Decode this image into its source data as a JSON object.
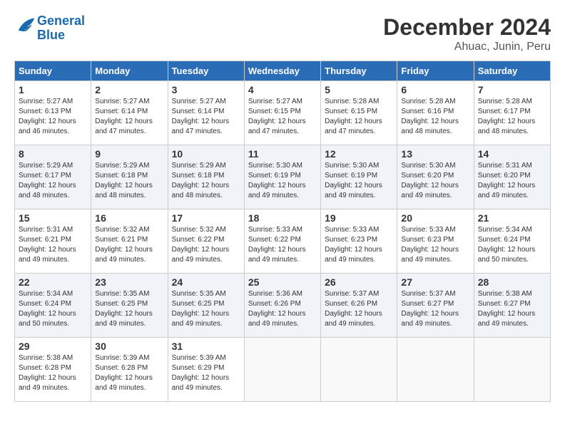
{
  "logo": {
    "line1": "General",
    "line2": "Blue"
  },
  "title": "December 2024",
  "location": "Ahuac, Junin, Peru",
  "days_of_week": [
    "Sunday",
    "Monday",
    "Tuesday",
    "Wednesday",
    "Thursday",
    "Friday",
    "Saturday"
  ],
  "weeks": [
    [
      {
        "day": "1",
        "info": "Sunrise: 5:27 AM\nSunset: 6:13 PM\nDaylight: 12 hours\nand 46 minutes."
      },
      {
        "day": "2",
        "info": "Sunrise: 5:27 AM\nSunset: 6:14 PM\nDaylight: 12 hours\nand 47 minutes."
      },
      {
        "day": "3",
        "info": "Sunrise: 5:27 AM\nSunset: 6:14 PM\nDaylight: 12 hours\nand 47 minutes."
      },
      {
        "day": "4",
        "info": "Sunrise: 5:27 AM\nSunset: 6:15 PM\nDaylight: 12 hours\nand 47 minutes."
      },
      {
        "day": "5",
        "info": "Sunrise: 5:28 AM\nSunset: 6:15 PM\nDaylight: 12 hours\nand 47 minutes."
      },
      {
        "day": "6",
        "info": "Sunrise: 5:28 AM\nSunset: 6:16 PM\nDaylight: 12 hours\nand 48 minutes."
      },
      {
        "day": "7",
        "info": "Sunrise: 5:28 AM\nSunset: 6:17 PM\nDaylight: 12 hours\nand 48 minutes."
      }
    ],
    [
      {
        "day": "8",
        "info": "Sunrise: 5:29 AM\nSunset: 6:17 PM\nDaylight: 12 hours\nand 48 minutes."
      },
      {
        "day": "9",
        "info": "Sunrise: 5:29 AM\nSunset: 6:18 PM\nDaylight: 12 hours\nand 48 minutes."
      },
      {
        "day": "10",
        "info": "Sunrise: 5:29 AM\nSunset: 6:18 PM\nDaylight: 12 hours\nand 48 minutes."
      },
      {
        "day": "11",
        "info": "Sunrise: 5:30 AM\nSunset: 6:19 PM\nDaylight: 12 hours\nand 49 minutes."
      },
      {
        "day": "12",
        "info": "Sunrise: 5:30 AM\nSunset: 6:19 PM\nDaylight: 12 hours\nand 49 minutes."
      },
      {
        "day": "13",
        "info": "Sunrise: 5:30 AM\nSunset: 6:20 PM\nDaylight: 12 hours\nand 49 minutes."
      },
      {
        "day": "14",
        "info": "Sunrise: 5:31 AM\nSunset: 6:20 PM\nDaylight: 12 hours\nand 49 minutes."
      }
    ],
    [
      {
        "day": "15",
        "info": "Sunrise: 5:31 AM\nSunset: 6:21 PM\nDaylight: 12 hours\nand 49 minutes."
      },
      {
        "day": "16",
        "info": "Sunrise: 5:32 AM\nSunset: 6:21 PM\nDaylight: 12 hours\nand 49 minutes."
      },
      {
        "day": "17",
        "info": "Sunrise: 5:32 AM\nSunset: 6:22 PM\nDaylight: 12 hours\nand 49 minutes."
      },
      {
        "day": "18",
        "info": "Sunrise: 5:33 AM\nSunset: 6:22 PM\nDaylight: 12 hours\nand 49 minutes."
      },
      {
        "day": "19",
        "info": "Sunrise: 5:33 AM\nSunset: 6:23 PM\nDaylight: 12 hours\nand 49 minutes."
      },
      {
        "day": "20",
        "info": "Sunrise: 5:33 AM\nSunset: 6:23 PM\nDaylight: 12 hours\nand 49 minutes."
      },
      {
        "day": "21",
        "info": "Sunrise: 5:34 AM\nSunset: 6:24 PM\nDaylight: 12 hours\nand 50 minutes."
      }
    ],
    [
      {
        "day": "22",
        "info": "Sunrise: 5:34 AM\nSunset: 6:24 PM\nDaylight: 12 hours\nand 50 minutes."
      },
      {
        "day": "23",
        "info": "Sunrise: 5:35 AM\nSunset: 6:25 PM\nDaylight: 12 hours\nand 49 minutes."
      },
      {
        "day": "24",
        "info": "Sunrise: 5:35 AM\nSunset: 6:25 PM\nDaylight: 12 hours\nand 49 minutes."
      },
      {
        "day": "25",
        "info": "Sunrise: 5:36 AM\nSunset: 6:26 PM\nDaylight: 12 hours\nand 49 minutes."
      },
      {
        "day": "26",
        "info": "Sunrise: 5:37 AM\nSunset: 6:26 PM\nDaylight: 12 hours\nand 49 minutes."
      },
      {
        "day": "27",
        "info": "Sunrise: 5:37 AM\nSunset: 6:27 PM\nDaylight: 12 hours\nand 49 minutes."
      },
      {
        "day": "28",
        "info": "Sunrise: 5:38 AM\nSunset: 6:27 PM\nDaylight: 12 hours\nand 49 minutes."
      }
    ],
    [
      {
        "day": "29",
        "info": "Sunrise: 5:38 AM\nSunset: 6:28 PM\nDaylight: 12 hours\nand 49 minutes."
      },
      {
        "day": "30",
        "info": "Sunrise: 5:39 AM\nSunset: 6:28 PM\nDaylight: 12 hours\nand 49 minutes."
      },
      {
        "day": "31",
        "info": "Sunrise: 5:39 AM\nSunset: 6:29 PM\nDaylight: 12 hours\nand 49 minutes."
      },
      {
        "day": "",
        "info": ""
      },
      {
        "day": "",
        "info": ""
      },
      {
        "day": "",
        "info": ""
      },
      {
        "day": "",
        "info": ""
      }
    ]
  ]
}
